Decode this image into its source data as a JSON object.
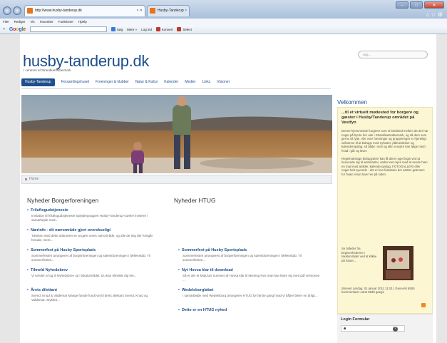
{
  "browser": {
    "tabs": [
      {
        "label": "http://www.husby-tanderup.dk",
        "active": true
      },
      {
        "label": "Husby-Tanderup",
        "active": false
      }
    ],
    "menu": [
      "Filer",
      "Rediger",
      "Vis",
      "Favoritter",
      "Funktioner",
      "Hjælp"
    ],
    "toolbar": {
      "search_brand": "Google",
      "items": [
        "Søg",
        "Mere »",
        "Log ind",
        "Konvert",
        "Select"
      ]
    },
    "window_controls": [
      "–",
      "□",
      "✕"
    ]
  },
  "site": {
    "logo": "husby-tanderup.dk",
    "tagline": "I centrum af Strandkantsdanmark",
    "search_placeholder": "søg...",
    "nav": [
      {
        "label": "Husby-Tanderup",
        "active": true
      },
      {
        "label": "Forsamlingshuset"
      },
      {
        "label": "Foreninger & klubber"
      },
      {
        "label": "Natur & Kultur"
      },
      {
        "label": "Kalender"
      },
      {
        "label": "Medier"
      },
      {
        "label": "Links"
      },
      {
        "label": "Visioner"
      }
    ],
    "breadcrumb": "Home"
  },
  "left_col": {
    "title": "Nyheder Borgerforeningen",
    "items": [
      {
        "heading": "Friluftsgudstjeneste",
        "text": "Invitation til friluftsgudstjeneste Spejdergruppen Husby-Tanderup-Gørlev inviterer i samarbejde med..."
      },
      {
        "heading": "Nærinfo - dit nærområde gjort overskueligt",
        "text": "Tænken med dette dokument er at gøre vores nærområde, og alle de ting der foregår herude, mere..."
      },
      {
        "heading": "Sommerfest på Husby Sportsplads",
        "text": "Sommerfesten arrangeres af borgerforeningen og stævtsforeningen i fællesskab. Til sommerfesten..."
      },
      {
        "heading": "Tilmeld Nyhedsbrev",
        "text": "Vi sender af og til Nyhedsbrev ud i lokalområdet. Du kan tilmelde dig her..."
      },
      {
        "heading": "Årets dilettant",
        "text": "Svend, Knud & Valdemar Mange havde fundt vej til årets dilettant Svend, Knud og Valdemar. Stykket..."
      }
    ]
  },
  "right_col": {
    "title": "Nyheder HTUG",
    "items": [
      {
        "heading": "Sommerfest på Husby Sportsplads",
        "text": "Sommerfesten arrangeres af borgerforeningen og stævtsforeningen i fællesskab. Til sommerfesten..."
      },
      {
        "heading": "Nyt Hovsa klar til download",
        "text": "Så er der et Maj/Juni nummer af Hovsa klar til læsning hvis man kan klare sig med pdf versionen ..."
      },
      {
        "heading": "Wedelsborgløbet",
        "text": "I samarbejde med Wedelsborg arrangerer HTUG for første gang hvad vi håber bliver en årligt..."
      },
      {
        "heading": "Dette er en HTUG nyhed",
        "text": ""
      }
    ]
  },
  "sidebar": {
    "heading": "Velkommen",
    "intro_title": "...til et virtuelt mødested for borgere og gæster i Husby/Tanderup området på Vestfyn",
    "p1": "Denne hjemmeside fungerer som et bindeled mellem de der har noget på hjerte her ude i Strandkantsdanmark, og så dem som gerne vil lytte. Alle vore foreninger og grupperinger er hjerteligt velkomne til at bidrage med nyheder, pålmeldelser og kalenderopslag, så både i selv og alle vi andre kan følge med i hvad i går og laver.",
    "p2": "Regelmæssige bidragydere kan få deres eget login ved at henvende sig til webmaster, andre kan rejes med at sende ham en mail med artikler, kalenderopslag, FOTOGALLERI eller noget helt syvende - det er kun fantasien der sætter grænsen for hvad vi kan lave her på siden.",
    "photo_caption": "Se billeder fra begivenhederne i lokalområdet ved at klikke på fotoet ...",
    "footer_text": "Skrevet Lørdag, 01 januar 2011 11:01 | Generelt 6550 kommentarer  Læst 5530 gange",
    "footer_link": "Generelt"
  },
  "login": {
    "title": "Login Formular",
    "help": "?"
  }
}
